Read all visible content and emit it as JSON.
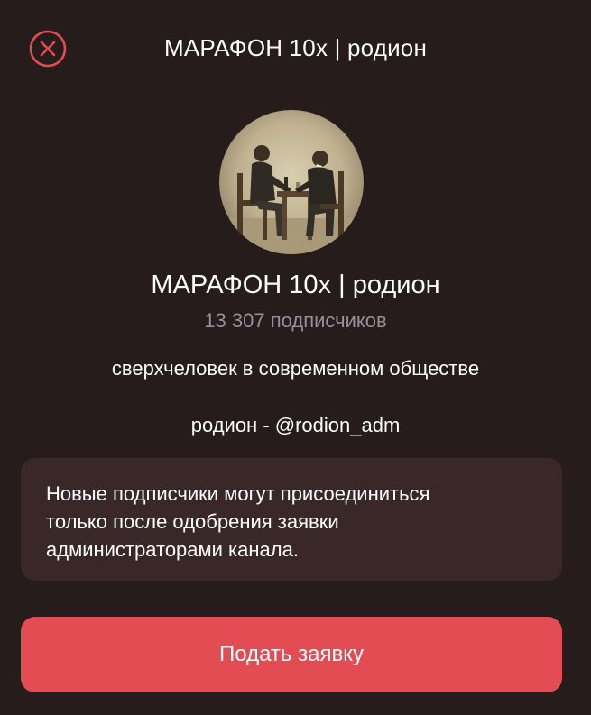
{
  "header": {
    "title": "МАРАФОН 10x | родион",
    "close_icon": "close-circle-icon"
  },
  "channel": {
    "avatar": "channel-avatar-illustration",
    "name": "МАРАФОН 10x | родион",
    "subscribers": "13 307 подписчиков",
    "description": "сверхчеловек в современном обществе",
    "admin": "родион - @rodion_adm"
  },
  "notice": {
    "text": "Новые подписчики могут присоединиться\nтолько после одобрения заявки\nадминистраторами канала."
  },
  "actions": {
    "request_label": "Подать заявку"
  },
  "colors": {
    "background": "#261c1c",
    "card": "#3a2828",
    "accent": "#e34c53",
    "muted": "#9a8f9c"
  }
}
